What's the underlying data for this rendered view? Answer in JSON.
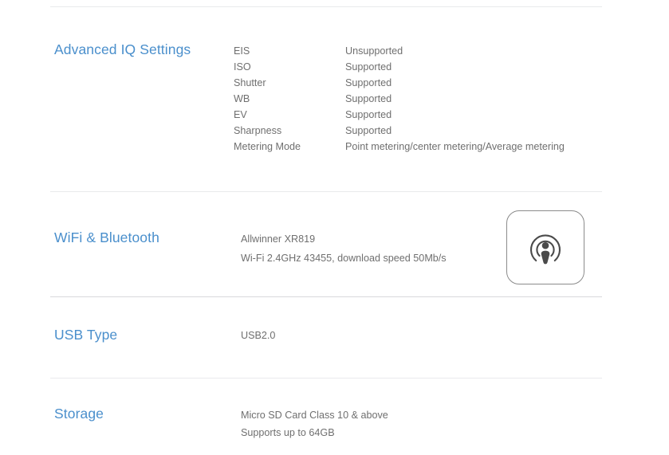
{
  "colors": {
    "heading_blue": "#4a8fcc",
    "body_gray": "#6f6f6f",
    "divider": "#e9eaec",
    "divider_strong": "#d8d9db",
    "icon_stroke": "#8b8b8b",
    "icon_fill": "#4a4a4a",
    "background": "#ffffff"
  },
  "sections": {
    "advanced_iq": {
      "heading": "Advanced IQ Settings",
      "rows": [
        {
          "label": "EIS",
          "value": "Unsupported"
        },
        {
          "label": "ISO",
          "value": "Supported"
        },
        {
          "label": "Shutter",
          "value": "Supported"
        },
        {
          "label": "WB",
          "value": "Supported"
        },
        {
          "label": "EV",
          "value": "Supported"
        },
        {
          "label": "Sharpness",
          "value": "Supported"
        },
        {
          "label": "Metering Mode",
          "value": "Point metering/center metering/Average metering"
        }
      ]
    },
    "wifi_bluetooth": {
      "heading": "WiFi & Bluetooth",
      "line1": "Allwinner XR819",
      "line2": "Wi-Fi 2.4GHz 43455, download speed 50Mb/s",
      "icon": "podcast-broadcast-icon"
    },
    "usb_type": {
      "heading": "USB Type",
      "line1": "USB2.0"
    },
    "storage": {
      "heading": "Storage",
      "line1": "Micro SD Card Class 10 & above",
      "line2": "Supports up to 64GB"
    }
  }
}
